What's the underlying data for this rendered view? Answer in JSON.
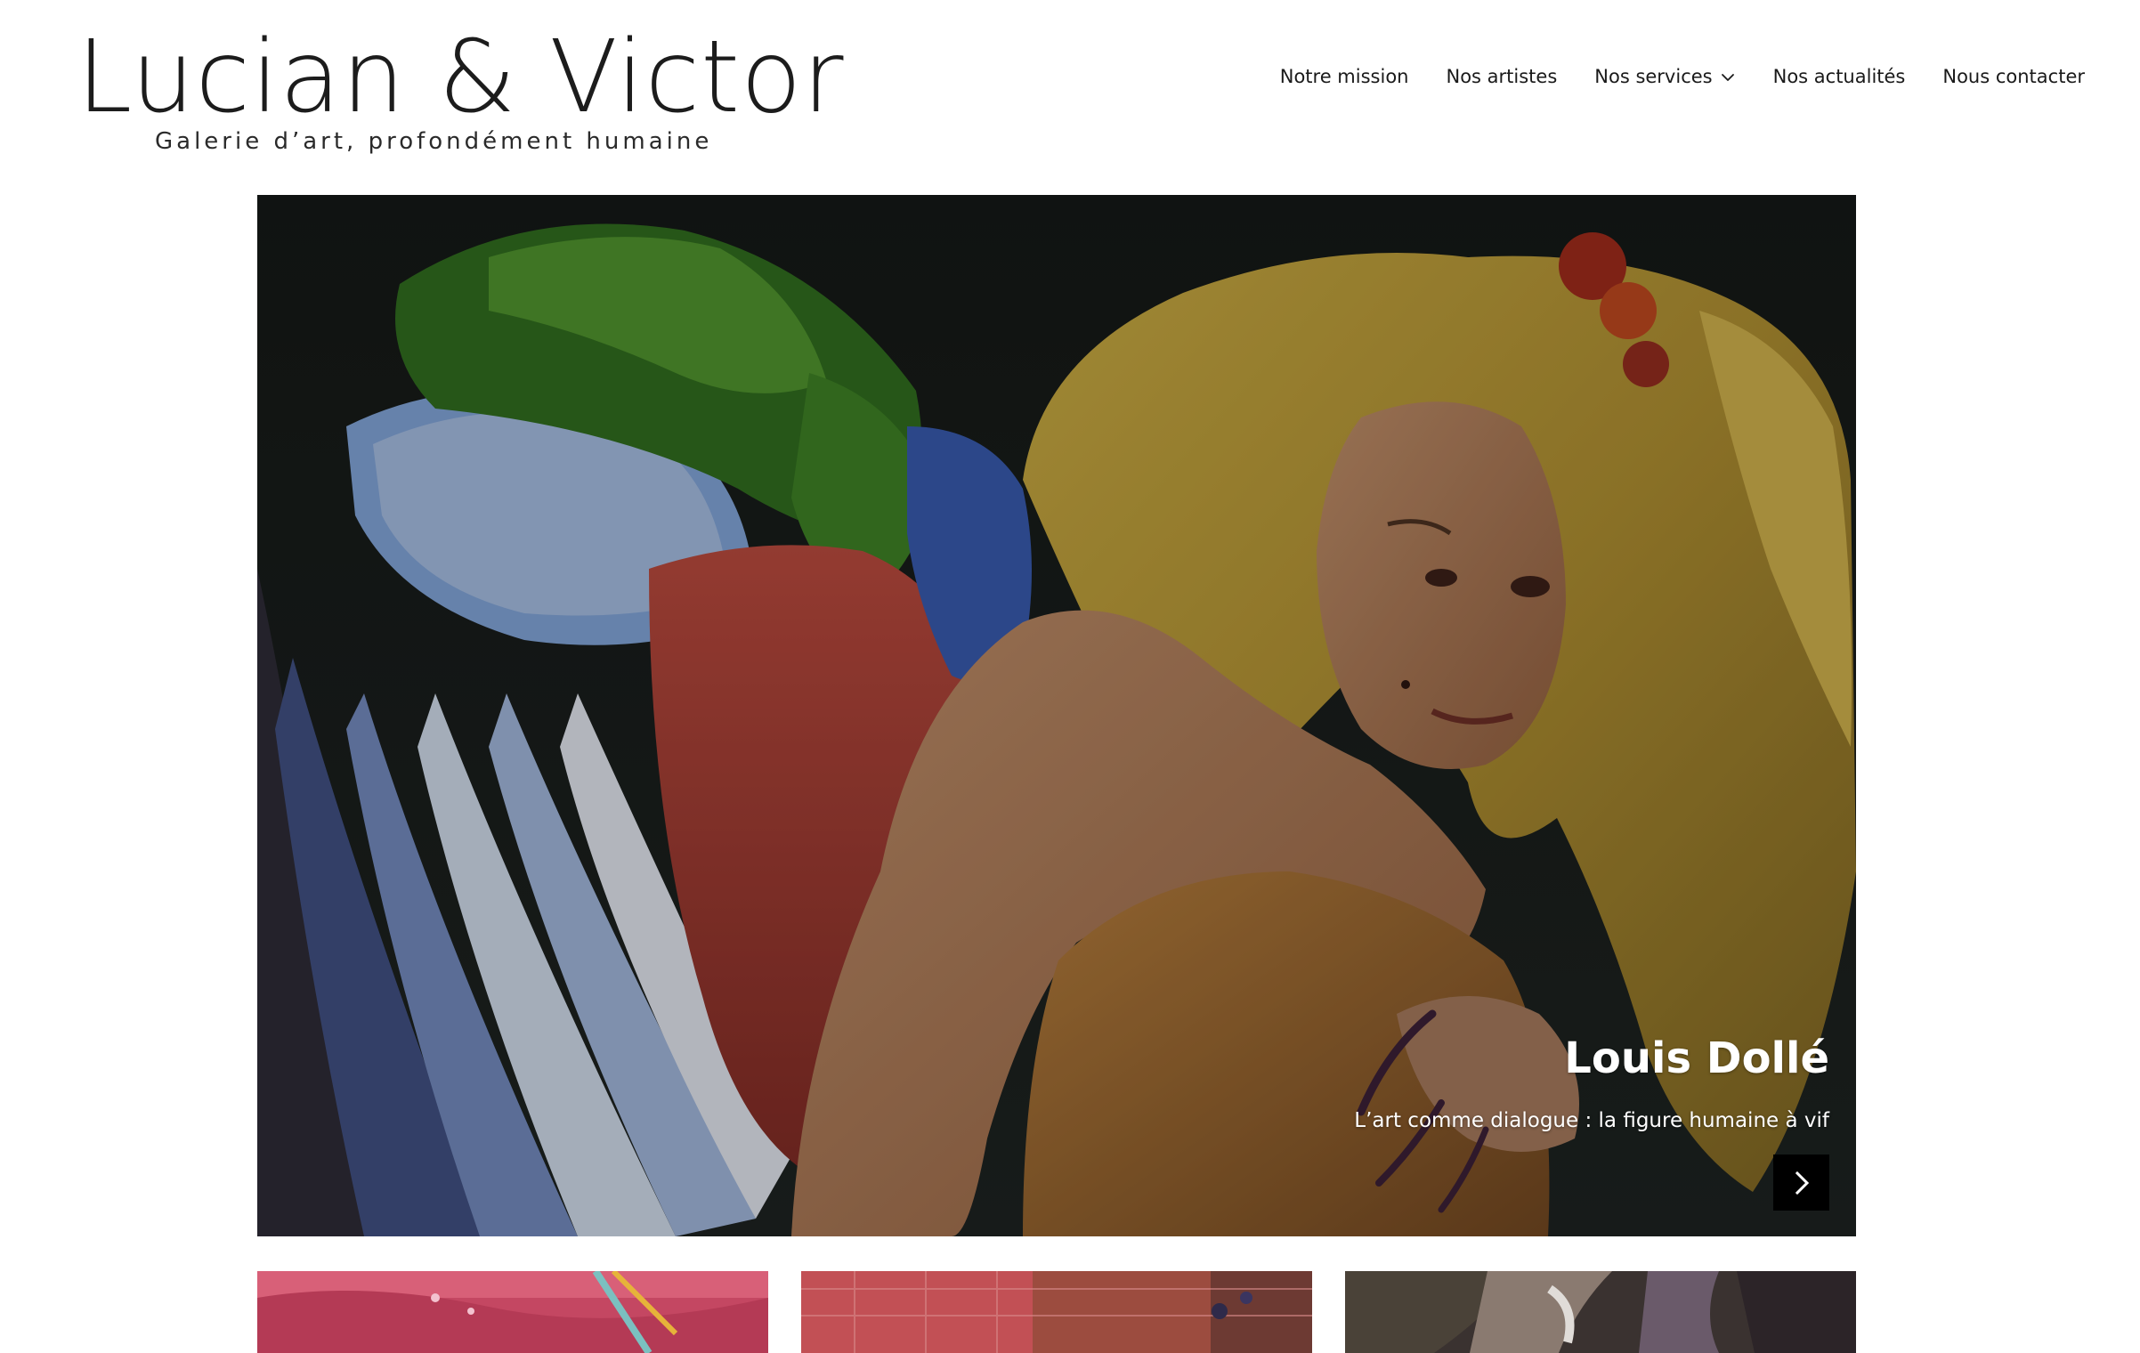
{
  "site": {
    "logo_title": "Lucian & Victor",
    "logo_tagline": "Galerie d’art, profondément humaine"
  },
  "nav": {
    "items": [
      {
        "label": "Notre mission"
      },
      {
        "label": "Nos artistes"
      },
      {
        "label": "Nos services",
        "has_dropdown": true
      },
      {
        "label": "Nos actualités"
      },
      {
        "label": "Nous contacter"
      }
    ]
  },
  "hero": {
    "title": "Louis Dollé",
    "subtitle": "L’art comme dialogue : la figure humaine à vif",
    "next_icon": "chevron-right-icon"
  },
  "thumbnails": [
    {
      "name": "thumbnail-artwork-1"
    },
    {
      "name": "thumbnail-artwork-2"
    },
    {
      "name": "thumbnail-artwork-3"
    }
  ],
  "colors": {
    "text": "#1a1a1a",
    "background": "#ffffff",
    "button": "#000000"
  }
}
